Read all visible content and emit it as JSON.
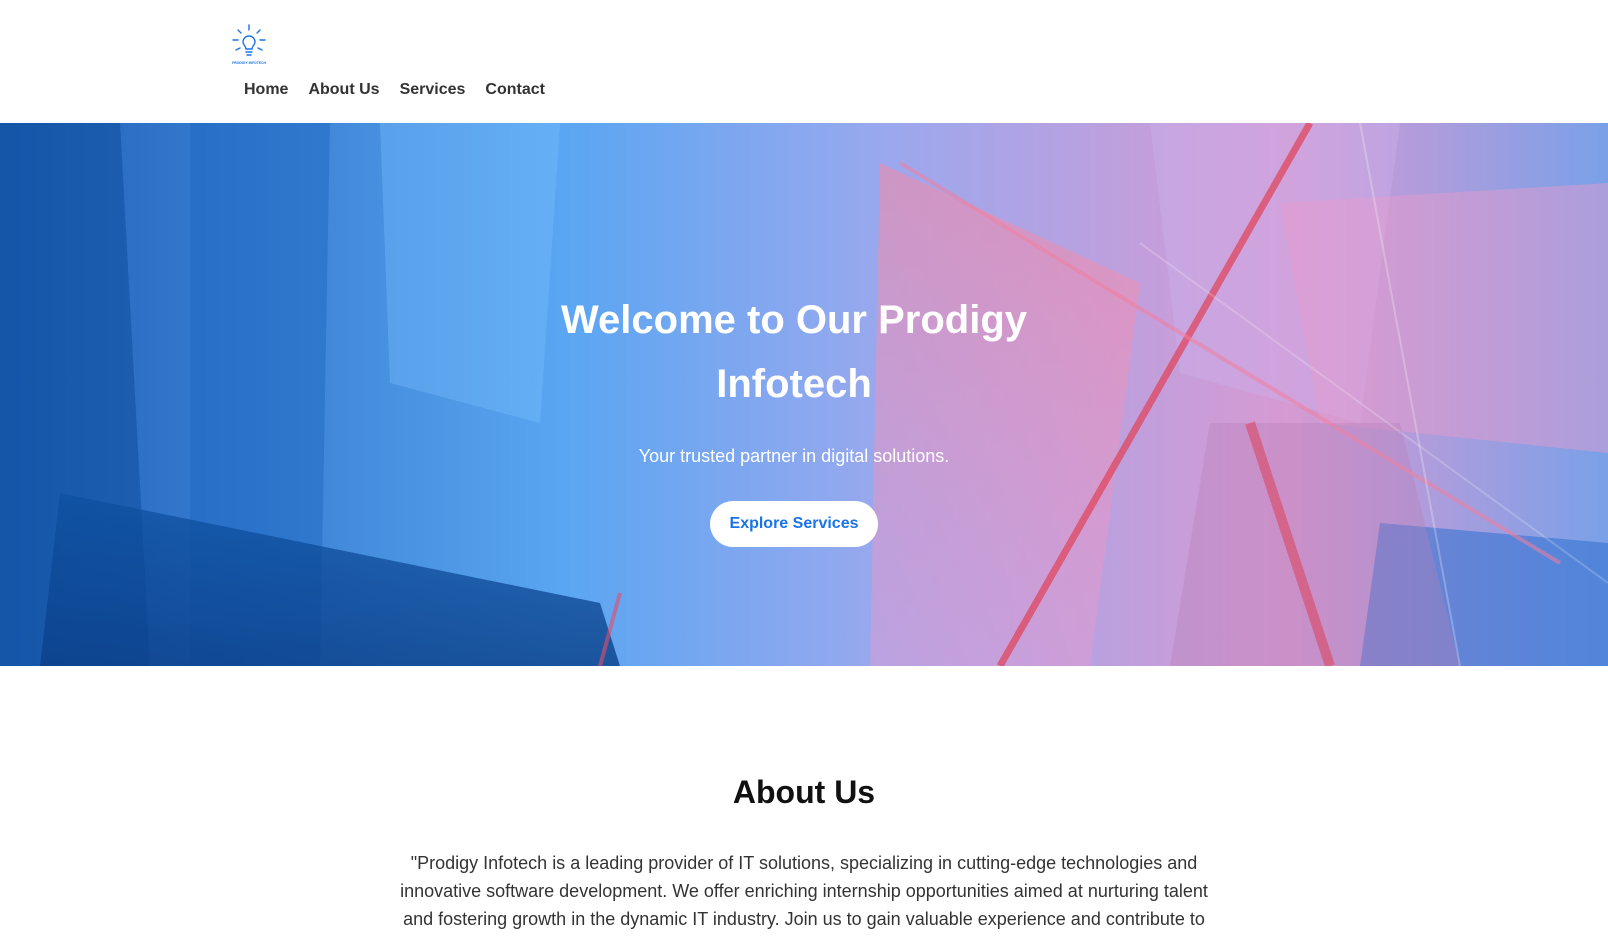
{
  "header": {
    "logo_icon": "lightbulb-icon",
    "logo_text": "PRODIGY INFOTECH",
    "nav": [
      {
        "label": "Home"
      },
      {
        "label": "About Us"
      },
      {
        "label": "Services"
      },
      {
        "label": "Contact"
      }
    ]
  },
  "hero": {
    "title": "Welcome to Our Prodigy Infotech",
    "subtitle": "Your trusted partner in digital solutions.",
    "button_label": "Explore Services"
  },
  "about": {
    "title": "About Us",
    "text": "\"Prodigy Infotech is a leading provider of IT solutions, specializing in cutting-edge technologies and innovative software development. We offer enriching internship opportunities aimed at nurturing talent and fostering growth in the dynamic IT industry. Join us to gain valuable experience and contribute to"
  },
  "colors": {
    "accent": "#1a73e8",
    "nav_text": "#333333",
    "hero_text": "#ffffff"
  }
}
